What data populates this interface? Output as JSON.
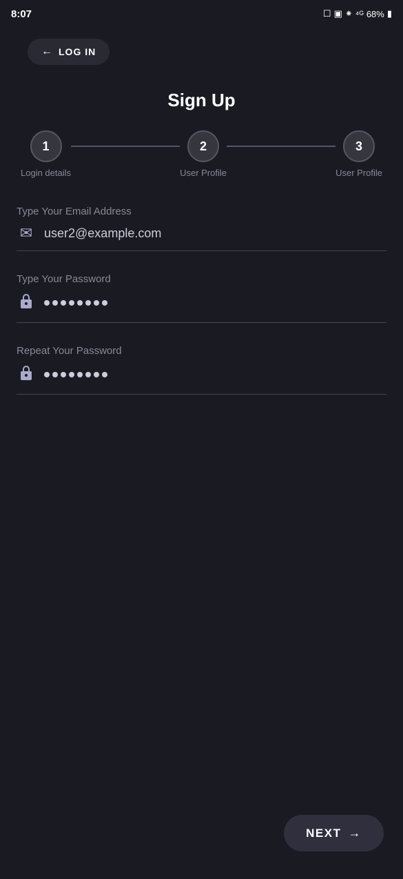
{
  "statusBar": {
    "time": "8:07",
    "battery": "68%",
    "icons": [
      "●",
      "▣",
      "⊞",
      "※",
      "46",
      "68%",
      "🔋"
    ]
  },
  "backButton": {
    "label": "LOG IN",
    "arrowIcon": "←"
  },
  "pageTitle": "Sign Up",
  "stepper": {
    "steps": [
      {
        "number": "1",
        "label": "Login details"
      },
      {
        "number": "2",
        "label": "User Profile"
      },
      {
        "number": "3",
        "label": "User Profile"
      }
    ]
  },
  "form": {
    "emailLabel": "Type Your Email Address",
    "emailValue": "user2@example.com",
    "emailIcon": "✉",
    "passwordLabel": "Type Your Password",
    "passwordValue": "••••••••",
    "passwordIcon": "🔒",
    "repeatPasswordLabel": "Repeat Your Password",
    "repeatPasswordValue": "••••••••",
    "repeatPasswordIcon": "🔒"
  },
  "nextButton": {
    "label": "NEXT",
    "arrowIcon": "→"
  }
}
